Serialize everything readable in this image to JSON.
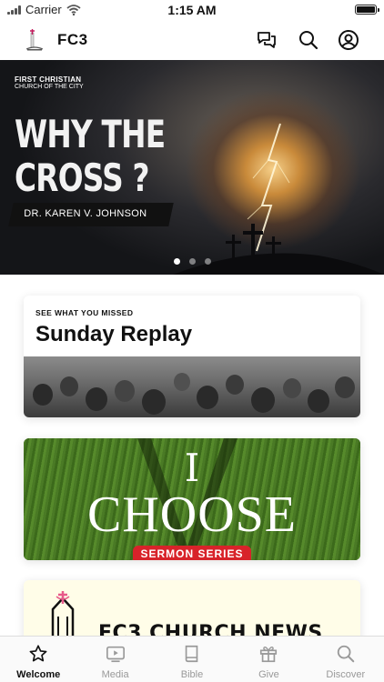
{
  "status_bar": {
    "carrier": "Carrier",
    "time": "1:15 AM"
  },
  "header": {
    "title": "FC3",
    "icons": [
      "chat-icon",
      "search-icon",
      "profile-icon"
    ]
  },
  "hero": {
    "brand_line1": "FIRST CHRISTIAN",
    "brand_line2": "CHURCH OF THE CITY",
    "title": "WHY THE\nCROSS ?",
    "speaker": "DR. KAREN V. JOHNSON",
    "slide_count": 3,
    "active_slide": 1
  },
  "cards": {
    "replay": {
      "eyebrow": "SEE WHAT YOU MISSED",
      "title": "Sunday Replay"
    },
    "sermon": {
      "line1": "I",
      "line2": "CHOOSE",
      "badge": "SERMON SERIES"
    },
    "news": {
      "title": "FC3 CHURCH NEWS"
    }
  },
  "tabs": [
    {
      "label": "Welcome",
      "icon": "star-icon",
      "active": true
    },
    {
      "label": "Media",
      "icon": "play-icon",
      "active": false
    },
    {
      "label": "Bible",
      "icon": "book-icon",
      "active": false
    },
    {
      "label": "Give",
      "icon": "gift-icon",
      "active": false
    },
    {
      "label": "Discover",
      "icon": "search-icon",
      "active": false
    }
  ],
  "colors": {
    "accent_red": "#d8232a",
    "tab_inactive": "#999999",
    "grass": "#3f6a1f"
  }
}
